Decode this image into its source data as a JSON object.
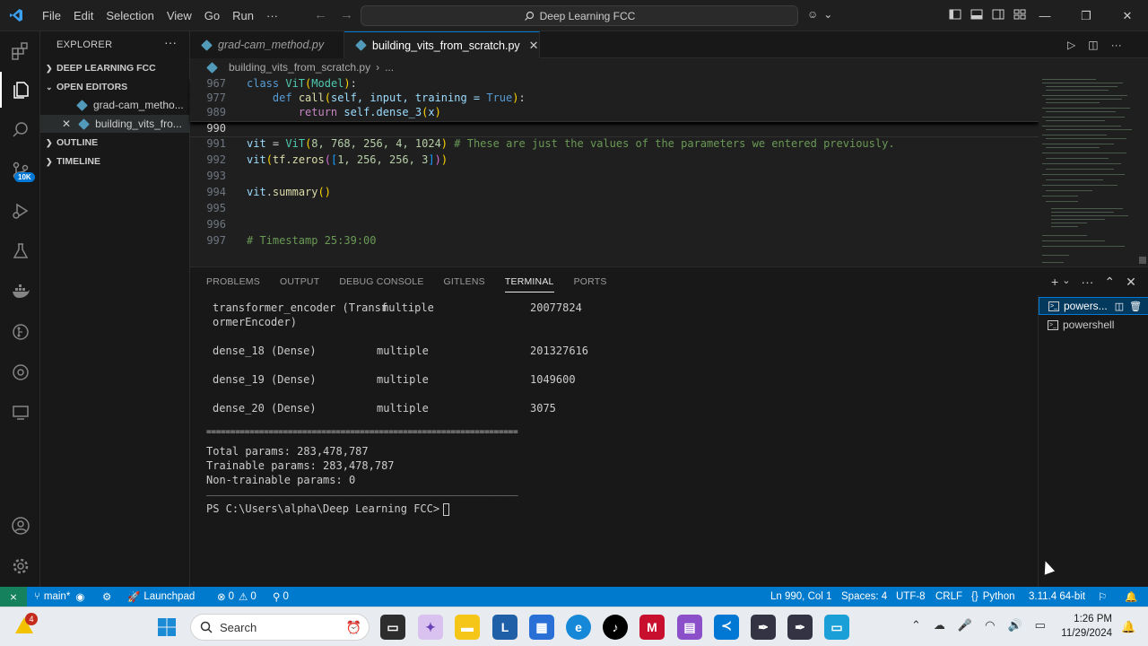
{
  "titlebar": {
    "menu": [
      "File",
      "Edit",
      "Selection",
      "View",
      "Go",
      "Run",
      "···"
    ],
    "search": "Deep Learning FCC"
  },
  "sidebar": {
    "header": "EXPLORER",
    "project": "DEEP LEARNING FCC",
    "open_editors": "OPEN EDITORS",
    "files": [
      "grad-cam_metho...",
      "building_vits_fro..."
    ],
    "outline": "OUTLINE",
    "timeline": "TIMELINE",
    "scm_badge": "10K"
  },
  "tabs": [
    {
      "label": "grad-cam_method.py"
    },
    {
      "label": "building_vits_from_scratch.py"
    }
  ],
  "breadcrumb": {
    "file": "building_vits_from_scratch.py",
    "more": "..."
  },
  "editor": {
    "lines": [
      {
        "n": "967"
      },
      {
        "n": "977"
      },
      {
        "n": "989"
      },
      {
        "n": "990"
      },
      {
        "n": "991"
      },
      {
        "n": "992"
      },
      {
        "n": "993"
      },
      {
        "n": "994"
      },
      {
        "n": "995"
      },
      {
        "n": "996"
      },
      {
        "n": "997"
      }
    ],
    "code": {
      "l967_kw": "class",
      "l967_cls": "ViT",
      "l967_base": "Model",
      "l977_kw": "def",
      "l977_fn": "call",
      "l977_args": "self, input, training = ",
      "l977_true": "True",
      "l989_kw": "return",
      "l989_call": "self.dense_3",
      "l989_arg": "x",
      "l991_var": "vit",
      "l991_cls": "ViT",
      "l991_args": "8, 768, 256, 4, 1024",
      "l991_cm": "# These are just the values of the parameters we entered previously.",
      "l992_var": "vit",
      "l992_fn": "tf.zeros",
      "l992_args": "1, 256, 256, 3",
      "l994_var": "vit",
      "l994_fn": "summary",
      "l997_cm": "# Timestamp 25:39:00"
    }
  },
  "panel": {
    "tabs": [
      "PROBLEMS",
      "OUTPUT",
      "DEBUG CONSOLE",
      "GITLENS",
      "TERMINAL",
      "PORTS"
    ],
    "terminal": {
      "rows": [
        {
          "name": "transformer_encoder (Transf",
          "shape": "multiple",
          "params": "20077824"
        },
        {
          "name": "ormerEncoder)",
          "shape": "",
          "params": ""
        },
        {
          "name": "dense_18 (Dense)",
          "shape": "multiple",
          "params": "201327616"
        },
        {
          "name": "dense_19 (Dense)",
          "shape": "multiple",
          "params": "1049600"
        },
        {
          "name": "dense_20 (Dense)",
          "shape": "multiple",
          "params": "3075"
        }
      ],
      "separator1": "=================================================================",
      "total": "Total params: 283,478,787",
      "trainable": "Trainable params: 283,478,787",
      "nontrainable": "Non-trainable params: 0",
      "separator2": "_________________________________________________________________",
      "prompt": "PS C:\\Users\\alpha\\Deep Learning FCC>"
    },
    "terminal_list": [
      "powers...",
      "powershell"
    ]
  },
  "statusbar": {
    "branch": "main*",
    "launchpad": "Launchpad",
    "errors": "0",
    "warnings": "0",
    "ports": "0",
    "position": "Ln 990, Col 1",
    "spaces": "Spaces: 4",
    "encoding": "UTF-8",
    "eol": "CRLF",
    "language": "Python",
    "interpreter": "3.11.4 64-bit"
  },
  "taskbar": {
    "weather_badge": "4",
    "search": "Search",
    "time": "1:26 PM",
    "date": "11/29/2024"
  },
  "colors": {
    "accent": "#0078d4",
    "status": "#007acc",
    "remote": "#16825d"
  }
}
